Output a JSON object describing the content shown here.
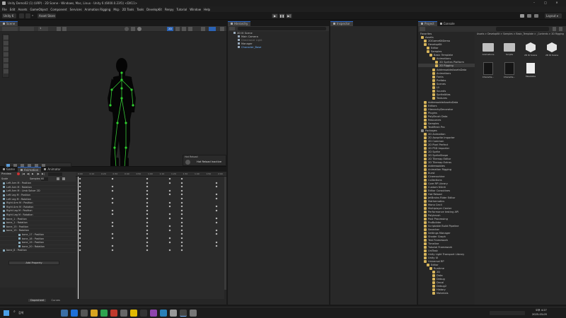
{
  "window_title": "Unity Demo02 (1) (URP) - 2D Scene - Windows, Mac, Linux - Unity 6 (6000.0.23f1) <DX11>",
  "menu": [
    "File",
    "Edit",
    "Assets",
    "GameObject",
    "Component",
    "Services",
    "Animation Rigging",
    "Mcp",
    "2D Tools",
    "Tools",
    "DevelopKit",
    "Renpy",
    "Tutorial",
    "Window",
    "Help"
  ],
  "toolbar": {
    "account": "Unity 6",
    "asset_store": "Asset Store ▾",
    "layout": "Layout ▾"
  },
  "scene": {
    "tab": "Scene",
    "view_2d": "2D",
    "gizmo_count": "1",
    "hot_reload_title": "Hot Reload",
    "hot_reload_status": "Hot Reload Inactive"
  },
  "animation": {
    "tabs": [
      "Game",
      "Animation",
      "Animator"
    ],
    "preview": "Preview",
    "sample_label": "Samples",
    "sample_value": "60",
    "scale_label": "Scale",
    "timeline_ticks": [
      "0:00",
      "0:10",
      "0:20",
      "0:30",
      "0:40",
      "0:50",
      "1:00",
      "1:10",
      "1:20",
      "1:30",
      "1:40",
      "1:50",
      "2:00",
      "2:10",
      "2:20",
      "2:30",
      "2:40",
      "2:50",
      "3:00"
    ],
    "properties": [
      "Left Arm M : Position",
      "Left Arm M : Rotation",
      "Left Arm M : Limb Solver 2D",
      "Left Leg M : Position",
      "Left Leg M : Rotation",
      "Right Arm M : Position",
      "Right Arm M : Rotation",
      "Right Leg M : Position",
      "Right Leg M : Rotation",
      "bone_1 : Position",
      "bone_1 : Rotation",
      "bone_15 : Position",
      "bone_15 : Rotation",
      "bone_17 : Position",
      "bone_18 : Position",
      "bone_19 : Position",
      "bone_20 : Rotation",
      "bone_8 : Position"
    ],
    "add_property": "Add Property",
    "dopesheet": "Dopesheet",
    "curves": "Curves"
  },
  "hierarchy": {
    "tab": "Hierarchy",
    "items": [
      "2D IK Scene",
      "Main Camera",
      "Directional Light",
      "Manager",
      "Character_Base"
    ]
  },
  "inspector": {
    "tab": "Inspector"
  },
  "project": {
    "tabs": [
      "Project",
      "Console"
    ],
    "favorites": "Favorites",
    "folders": [
      "Assets",
      "2DGameKitDemo",
      "DevelopKit",
      "Editor",
      "Samples",
      "Basic Template",
      "Animations",
      "2D Sprites Platform",
      "2D Rigging",
      "AddressableAssetsData",
      "Animations",
      "Fonts",
      "Prefabs",
      "Scenes",
      "UI",
      "Sounds",
      "SpriteAtlas",
      "Textures",
      "AddressableAssetsData",
      "Editors",
      "HierarchyDecorator",
      "Plugins",
      "PolyBrush Data",
      "Resources",
      "Samples",
      "TextMesh Pro",
      "Packages",
      "2D Animation",
      "2D Aseprite Importer",
      "2D Common",
      "2D Pixel Perfect",
      "2D PSD Importer",
      "2D Sprite",
      "2D SpriteShape",
      "2D Tilemap Editor",
      "2D Tilemap Extras",
      "Addressables",
      "Animation Rigging",
      "Burst",
      "Cinemachine",
      "Collections",
      "Core RP Library",
      "Custom NUnit",
      "Editor Coroutines",
      "Hot Reload",
      "JetBrains Rider Editor",
      "Mathematics",
      "Mono Cecil",
      "Multiplayer Center",
      "Performance testing API",
      "Polybrush",
      "Post Processing",
      "ProBuilder",
      "Scriptable Build Pipeline",
      "Searcher",
      "Settings Manager",
      "Shader Graph",
      "Test Framework",
      "Timeline",
      "Tutorial Framework",
      "UniTask",
      "Unity Light Transport Library",
      "Unity UI",
      "Universal RP",
      "Editor",
      "Runtime",
      "2D",
      "Data",
      "Debug",
      "Decal",
      "Debug2",
      "History",
      "Materials"
    ],
    "breadcrumb": "Assets > DevelopKit > Samples > Basic_Template > _Contents > 2D Rigging",
    "assets": [
      "Animations",
      "Scripts",
      "2D IK Scene",
      "2D IK Scene",
      "Characte...",
      "Characte...",
      "Maskable"
    ]
  },
  "taskbar": {
    "time": "오후 4:27",
    "date": "2025-03-05",
    "search": "검색"
  }
}
